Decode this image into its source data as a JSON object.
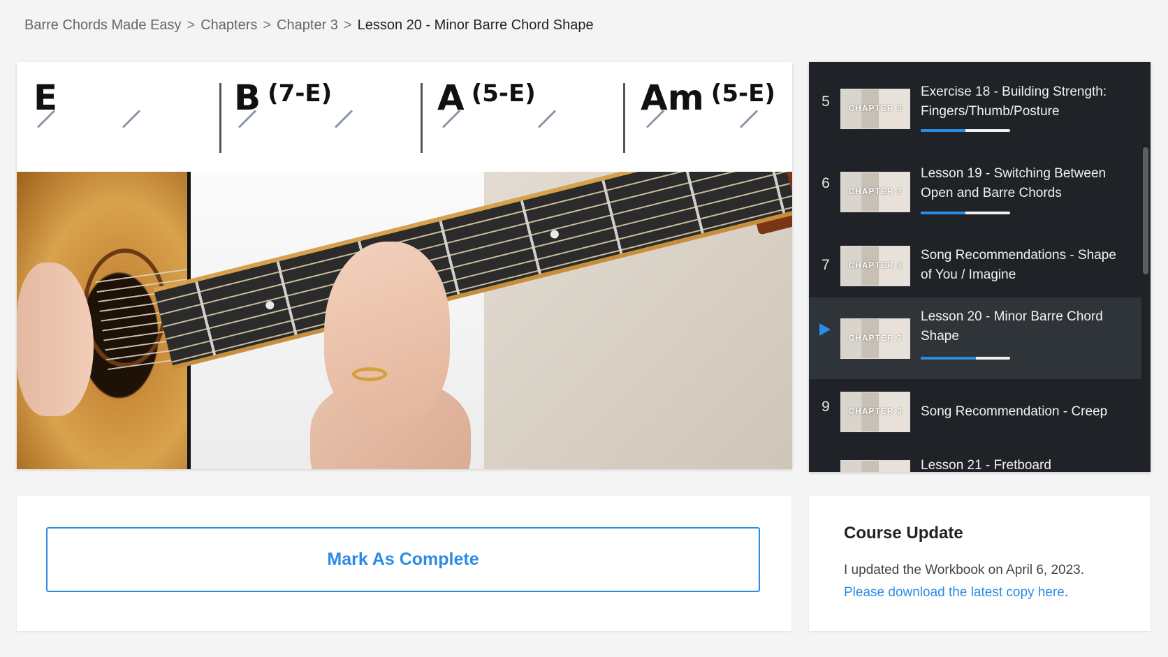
{
  "breadcrumb": {
    "items": [
      "Barre Chords Made Easy",
      "Chapters",
      "Chapter 3"
    ],
    "current": "Lesson 20 - Minor Barre Chord Shape",
    "separator": ">"
  },
  "chords": [
    {
      "name": "E",
      "sub": ""
    },
    {
      "name": "B",
      "sub": "(7-E)"
    },
    {
      "name": "A",
      "sub": "(5-E)"
    },
    {
      "name": "Am",
      "sub": "(5-E)"
    }
  ],
  "playlist": {
    "items": [
      {
        "num": "5",
        "title": "Exercise 18 - Building Strength: Fingers/Thumb/Posture",
        "thumb_label": "CHAPTER 3",
        "progress": 0.5,
        "active": false
      },
      {
        "num": "6",
        "title": "Lesson 19 - Switching Between Open and Barre Chords",
        "thumb_label": "CHAPTER 3",
        "progress": 0.5,
        "active": false
      },
      {
        "num": "7",
        "title": "Song Recommendations - Shape of You / Imagine",
        "thumb_label": "CHAPTER 3",
        "progress": null,
        "active": false
      },
      {
        "num": "",
        "title": "Lesson 20 - Minor Barre Chord Shape",
        "thumb_label": "CHAPTER 3",
        "progress": 0.62,
        "active": true
      },
      {
        "num": "9",
        "title": "Song Recommendation - Creep",
        "thumb_label": "CHAPTER 3",
        "progress": null,
        "active": false
      },
      {
        "num": "",
        "title": "Lesson 21 - Fretboard",
        "thumb_label": "",
        "progress": null,
        "active": false
      }
    ]
  },
  "complete": {
    "label": "Mark As Complete"
  },
  "update": {
    "title": "Course Update",
    "text": "I updated the Workbook on April 6, 2023.",
    "link": "Please download the latest copy here",
    "link_suffix": "."
  },
  "colors": {
    "accent": "#2b8ce6",
    "playlist_bg": "#1f2327",
    "active_row": "#2f3439"
  }
}
